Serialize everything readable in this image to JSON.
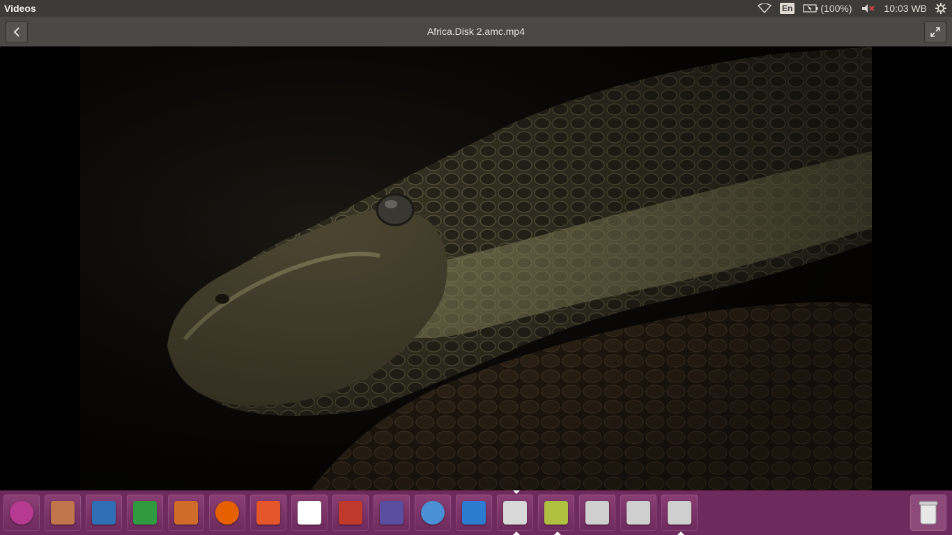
{
  "top_panel": {
    "app_title": "Videos",
    "language": "En",
    "battery": "(100%)",
    "clock": "10:03 WB",
    "icons": {
      "wifi": "wifi-icon",
      "keyboard": "keyboard-icon",
      "battery": "battery-icon",
      "volume": "volume-muted-icon",
      "settings": "settings-icon"
    }
  },
  "header": {
    "title": "Africa.Disk 2.amc.mp4",
    "back_icon": "back-icon",
    "fullscreen_icon": "fullscreen-icon"
  },
  "launcher": {
    "items": [
      {
        "name": "ubuntu-dash-icon",
        "color": "#b63a8f"
      },
      {
        "name": "files-icon",
        "color": "#c0764a"
      },
      {
        "name": "writer-icon",
        "color": "#2f6fb3"
      },
      {
        "name": "calc-icon",
        "color": "#2f9a3f"
      },
      {
        "name": "impress-icon",
        "color": "#d06b2a"
      },
      {
        "name": "firefox-icon",
        "color": "#e66000"
      },
      {
        "name": "software-center-icon",
        "color": "#e5572b"
      },
      {
        "name": "amazon-icon",
        "color": "#ffffff"
      },
      {
        "name": "system-settings-icon",
        "color": "#c0392b"
      },
      {
        "name": "game-icon",
        "color": "#5b4ea0"
      },
      {
        "name": "chromium-icon",
        "color": "#4b8fd4"
      },
      {
        "name": "vscode-icon",
        "color": "#2b7bd0"
      },
      {
        "name": "videos-icon",
        "color": "#d8d8d8"
      },
      {
        "name": "search-tool-icon",
        "color": "#b0c040"
      },
      {
        "name": "drive-1-icon",
        "color": "#cfcfcf"
      },
      {
        "name": "drive-2-icon",
        "color": "#cfcfcf"
      },
      {
        "name": "drive-3-icon",
        "color": "#cfcfcf"
      }
    ],
    "trash": "trash-icon"
  }
}
